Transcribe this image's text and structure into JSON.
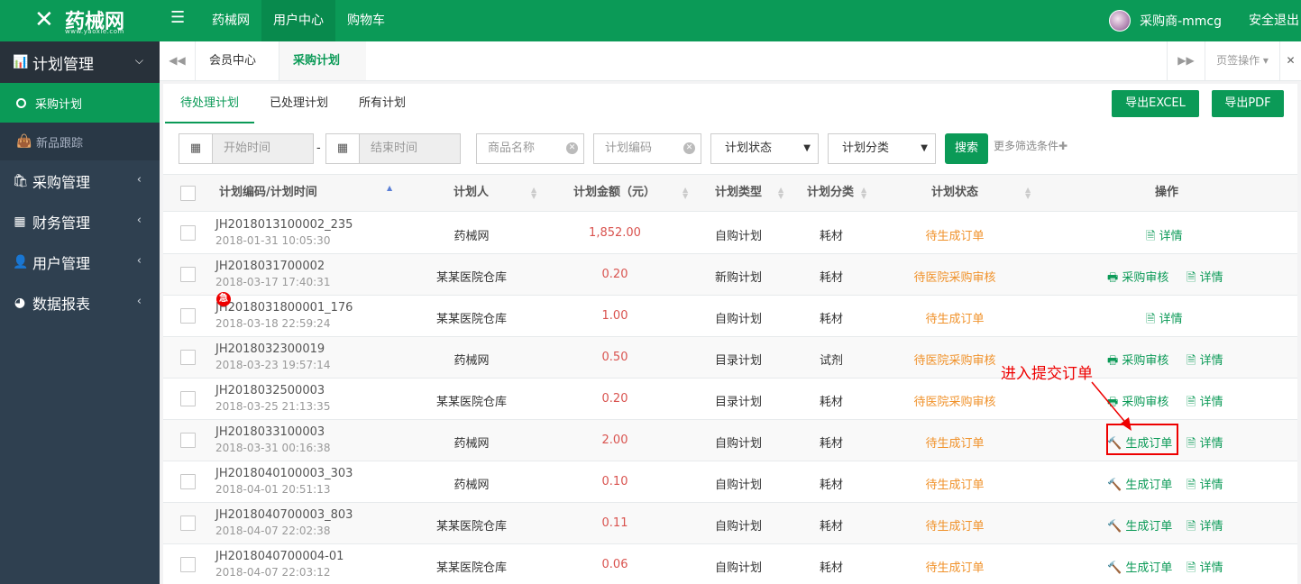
{
  "topbar": {
    "logo_text": "药械网",
    "logo_url": "www.yaoxie.com",
    "nav": [
      "药械网",
      "用户中心",
      "购物车"
    ],
    "user_name": "采购商-mmcg",
    "logout": "安全退出"
  },
  "sidebar": {
    "head": "计划管理",
    "sub_active": "采购计划",
    "sub_other": "新品跟踪",
    "items": [
      "采购管理",
      "财务管理",
      "用户管理",
      "数据报表"
    ]
  },
  "pagetabs": {
    "tab1": "会员中心",
    "tab2": "采购计划",
    "ops": "页签操作"
  },
  "subtabs": [
    "待处理计划",
    "已处理计划",
    "所有计划"
  ],
  "export": {
    "excel": "导出EXCEL",
    "pdf": "导出PDF"
  },
  "filters": {
    "start_placeholder": "开始时间",
    "end_placeholder": "结束时间",
    "product_placeholder": "商品名称",
    "code_placeholder": "计划编码",
    "status_select": "计划状态",
    "category_select": "计划分类",
    "search": "搜索",
    "more": "更多筛选条件"
  },
  "table": {
    "headers": [
      "计划编码/计划时间",
      "计划人",
      "计划金额（元）",
      "计划类型",
      "计划分类",
      "计划状态",
      "操作"
    ],
    "rows": [
      {
        "code": "JH2018013100002_235",
        "time": "2018-01-31 10:05:30",
        "planner": "药械网",
        "amount": "1,852.00",
        "type": "自购计划",
        "category": "耗材",
        "status": "待生成订单",
        "action": "",
        "detail": "详情"
      },
      {
        "code": "JH2018031700002",
        "time": "2018-03-17 17:40:31",
        "planner": "某某医院仓库",
        "amount": "0.20",
        "type": "新购计划",
        "category": "耗材",
        "status": "待医院采购审核",
        "action": "采购审核",
        "detail": "详情"
      },
      {
        "code": "JH2018031800001_176",
        "time": "2018-03-18 22:59:24",
        "planner": "某某医院仓库",
        "amount": "1.00",
        "type": "自购计划",
        "category": "耗材",
        "status": "待生成订单",
        "action": "",
        "detail": "详情"
      },
      {
        "code": "JH2018032300019",
        "time": "2018-03-23 19:57:14",
        "planner": "药械网",
        "amount": "0.50",
        "type": "目录计划",
        "category": "试剂",
        "status": "待医院采购审核",
        "action": "采购审核",
        "detail": "详情"
      },
      {
        "code": "JH2018032500003",
        "time": "2018-03-25 21:13:35",
        "planner": "某某医院仓库",
        "amount": "0.20",
        "type": "目录计划",
        "category": "耗材",
        "status": "待医院采购审核",
        "action": "采购审核",
        "detail": "详情"
      },
      {
        "code": "JH2018033100003",
        "time": "2018-03-31 00:16:38",
        "planner": "药械网",
        "amount": "2.00",
        "type": "自购计划",
        "category": "耗材",
        "status": "待生成订单",
        "action": "生成订单",
        "detail": "详情"
      },
      {
        "code": "JH2018040100003_303",
        "time": "2018-04-01 20:51:13",
        "planner": "药械网",
        "amount": "0.10",
        "type": "自购计划",
        "category": "耗材",
        "status": "待生成订单",
        "action": "生成订单",
        "detail": "详情"
      },
      {
        "code": "JH2018040700003_803",
        "time": "2018-04-07 22:02:38",
        "planner": "某某医院仓库",
        "amount": "0.11",
        "type": "自购计划",
        "category": "耗材",
        "status": "待生成订单",
        "action": "生成订单",
        "detail": "详情"
      },
      {
        "code": "JH2018040700004-01",
        "time": "2018-04-07 22:03:12",
        "planner": "某某医院仓库",
        "amount": "0.06",
        "type": "自购计划",
        "category": "耗材",
        "status": "待生成订单",
        "action": "生成订单",
        "detail": "详情"
      }
    ]
  },
  "urgent_badge": "急",
  "annotation": "进入提交订单",
  "colors": {
    "brand": "#0b9a57",
    "sidebar": "#2f4050",
    "amount": "#d9534f",
    "status": "#f0922b",
    "annotation": "#ee0000"
  }
}
